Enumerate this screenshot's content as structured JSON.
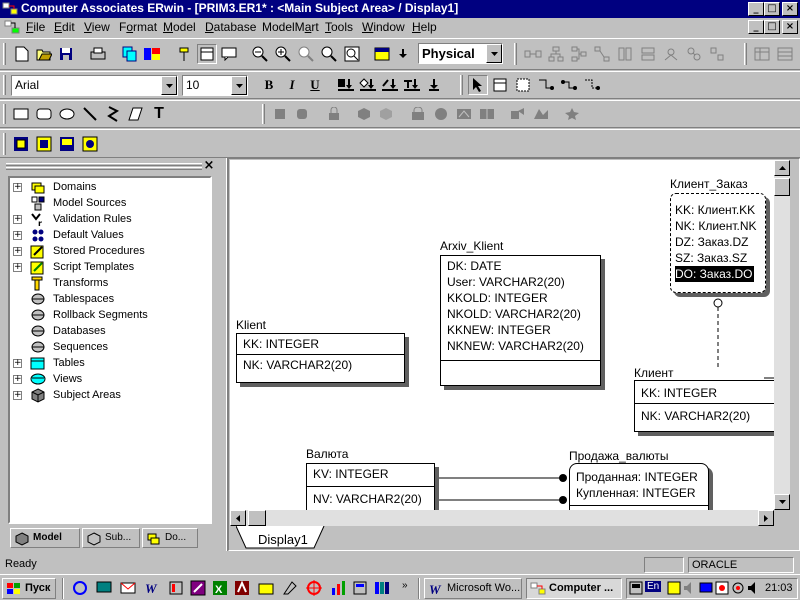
{
  "window": {
    "title": "Computer Associates ERwin - [PRIM3.ER1* : <Main Subject Area> / Display1]",
    "buttons": [
      "_",
      "□",
      "×"
    ]
  },
  "menu": {
    "items": [
      "File",
      "Edit",
      "View",
      "Format",
      "Model",
      "Database",
      "ModelMart",
      "Tools",
      "Window",
      "Help"
    ],
    "mnemonics": [
      "F",
      "E",
      "V",
      "o",
      "M",
      "D",
      "a",
      "T",
      "W",
      "H"
    ]
  },
  "toolbar": {
    "view_mode": "Physical",
    "font_name": "Arial",
    "font_size": "10",
    "bold_label": "B",
    "italic_label": "I",
    "underline_label": "U",
    "text_tool_label": "T"
  },
  "model_explorer": {
    "items": [
      {
        "label": "Domains",
        "expandable": true,
        "icon": "domains-icon"
      },
      {
        "label": "Model Sources",
        "expandable": false,
        "icon": "model-sources-icon"
      },
      {
        "label": "Validation Rules",
        "expandable": true,
        "icon": "validation-rules-icon"
      },
      {
        "label": "Default Values",
        "expandable": true,
        "icon": "default-values-icon"
      },
      {
        "label": "Stored Procedures",
        "expandable": true,
        "icon": "stored-procedures-icon"
      },
      {
        "label": "Script Templates",
        "expandable": true,
        "icon": "script-templates-icon"
      },
      {
        "label": "Transforms",
        "expandable": false,
        "icon": "transforms-icon"
      },
      {
        "label": "Tablespaces",
        "expandable": false,
        "icon": "tablespaces-icon"
      },
      {
        "label": "Rollback Segments",
        "expandable": false,
        "icon": "rollback-segments-icon"
      },
      {
        "label": "Databases",
        "expandable": false,
        "icon": "databases-icon"
      },
      {
        "label": "Sequences",
        "expandable": false,
        "icon": "sequences-icon"
      },
      {
        "label": "Tables",
        "expandable": true,
        "icon": "tables-icon"
      },
      {
        "label": "Views",
        "expandable": true,
        "icon": "views-icon"
      },
      {
        "label": "Subject Areas",
        "expandable": true,
        "icon": "subject-areas-icon"
      }
    ],
    "tabs": [
      "Model",
      "Sub...",
      "Do..."
    ],
    "close_glyph": "×"
  },
  "diagram": {
    "tab": "Display1",
    "entities": {
      "klient_zakaz": {
        "name": "Клиент_Заказ",
        "rows": [
          "KK: Клиент.KK",
          "NK: Клиент.NK",
          "DZ: Заказ.DZ",
          "SZ: Заказ.SZ",
          "DO: Заказ.DO"
        ],
        "selected_row": "DO: Заказ.DO"
      },
      "arxiv_klient": {
        "name": "Arxiv_Klient",
        "rows": [
          "DK: DATE",
          "User: VARCHAR2(20)",
          "KKOLD: INTEGER",
          "NKOLD: VARCHAR2(20)",
          "KKNEW: INTEGER",
          "NKNEW: VARCHAR2(20)"
        ]
      },
      "klient_latin": {
        "name": "Klient",
        "key": "KK: INTEGER",
        "nonkey": "NK: VARCHAR2(20)"
      },
      "klient_cyr": {
        "name": "Клиент",
        "key": "KK: INTEGER",
        "nonkey": "NK: VARCHAR2(20)"
      },
      "valyuta": {
        "name": "Валюта",
        "key": "KV: INTEGER",
        "nonkey": "NV: VARCHAR2(20)"
      },
      "prodazha": {
        "name": "Продажа_валюты",
        "rows": [
          "Проданная: INTEGER",
          "Купленная: INTEGER"
        ]
      }
    }
  },
  "status": {
    "left": "Ready",
    "db": "ORACLE"
  },
  "taskbar": {
    "start": "Пуск",
    "tasks": [
      "Microsoft Wo...",
      "Computer ..."
    ],
    "lang": "En",
    "clock": "21:03"
  }
}
